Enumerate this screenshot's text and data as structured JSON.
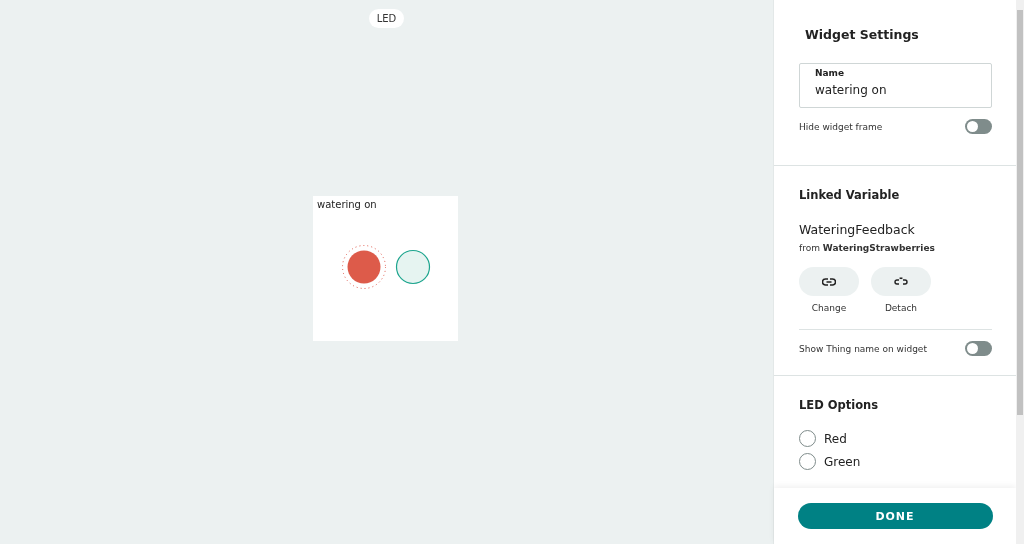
{
  "canvas": {
    "badge": "LED",
    "widget": {
      "title": "watering on",
      "led_on": true
    }
  },
  "settings": {
    "title": "Widget Settings",
    "name_field": {
      "label": "Name",
      "value": "watering on"
    },
    "hide_frame": {
      "label": "Hide widget frame",
      "on": false
    }
  },
  "linked_variable": {
    "title": "Linked Variable",
    "variable": "WateringFeedback",
    "from": "from **WateringStrawberries**",
    "actions": [
      {
        "kind": "change",
        "label": "Change"
      },
      {
        "kind": "detach",
        "label": "Detach"
      }
    ],
    "show_thing": {
      "label": "Show Thing name on widget",
      "on": false
    }
  },
  "led_options": {
    "title": "LED Options",
    "options": [
      {
        "label": "Red",
        "selected": false
      },
      {
        "label": "Green",
        "selected": false
      }
    ]
  },
  "done_button": "DONE"
}
